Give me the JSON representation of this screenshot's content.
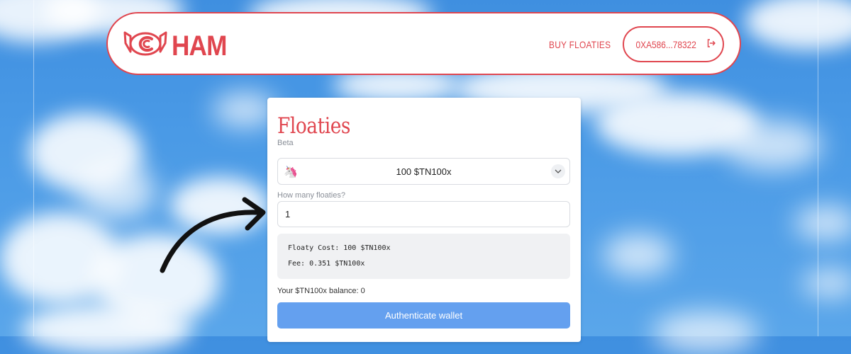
{
  "header": {
    "brand": "HAM",
    "nav_link": "BUY FLOATIES",
    "wallet_label": "0XA586...78322"
  },
  "card": {
    "title": "Floaties",
    "subtitle": "Beta",
    "token_select": {
      "value": "100 $TN100x",
      "icon": "unicorn-icon"
    },
    "quantity": {
      "label": "How many floaties?",
      "value": "1"
    },
    "summary": {
      "cost": "Floaty Cost: 100 $TN100x",
      "fee": "Fee: 0.351 $TN100x"
    },
    "balance": "Your $TN100x balance: 0",
    "button_label": "Authenticate wallet"
  },
  "colors": {
    "brand_red": "#e0464f",
    "button_blue": "#64a0ef",
    "sky": "#4a9ae6"
  }
}
